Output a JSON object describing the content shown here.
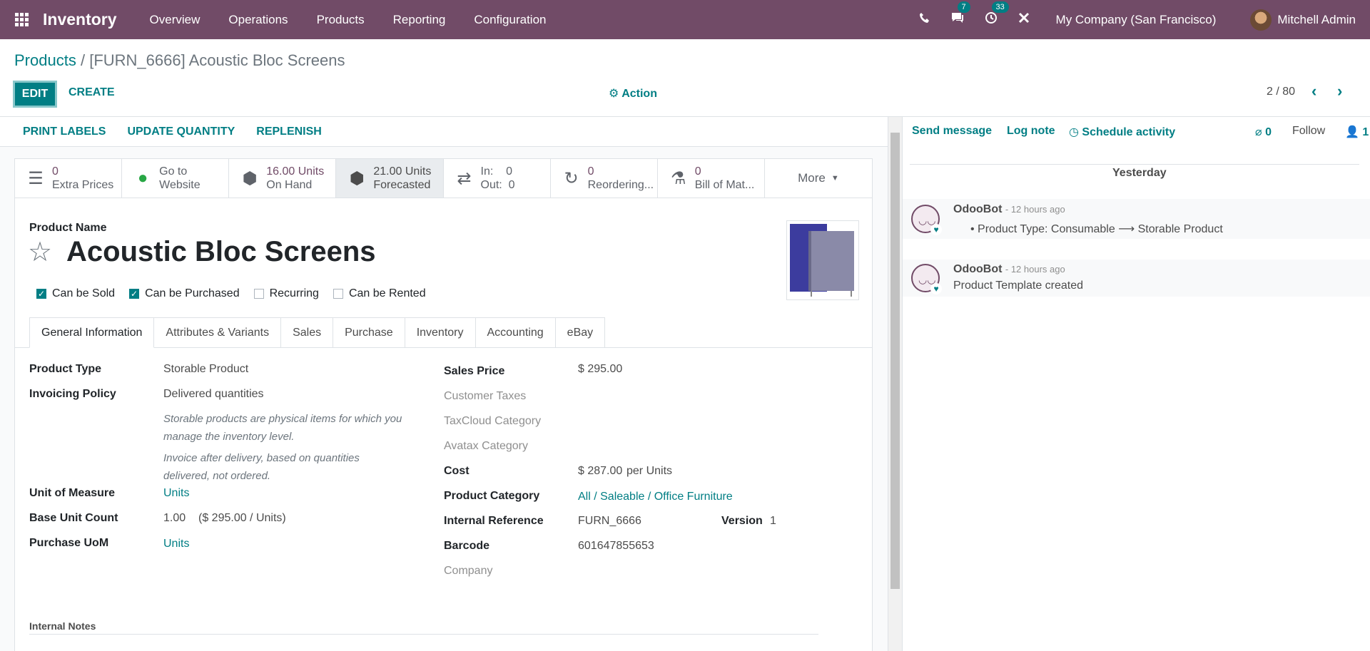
{
  "navbar": {
    "app_name": "Inventory",
    "menus": [
      "Overview",
      "Operations",
      "Products",
      "Reporting",
      "Configuration"
    ],
    "messages_count": "7",
    "activities_count": "33",
    "company": "My Company (San Francisco)",
    "user": "Mitchell Admin",
    "brand_color": "#714b67"
  },
  "control": {
    "breadcrumb_root": "Products",
    "breadcrumb_sep": "/",
    "breadcrumb_current": "[FURN_6666] Acoustic Bloc Screens",
    "edit_label": "EDIT",
    "create_label": "CREATE",
    "action_label": "Action",
    "pager": "2 / 80",
    "accent_color": "#017e84"
  },
  "statusbar": [
    "PRINT LABELS",
    "UPDATE QUANTITY",
    "REPLENISH"
  ],
  "smart_buttons": [
    {
      "icon": "list-icon",
      "value": "0",
      "label": "Extra Prices"
    },
    {
      "icon": "globe-icon",
      "value": "Go to",
      "label": "Website"
    },
    {
      "icon": "cubes-icon",
      "value": "16.00 Units",
      "label": "On Hand"
    },
    {
      "icon": "cubes-icon",
      "value": "21.00 Units",
      "label": "Forecasted"
    },
    {
      "icon": "exchange-icon",
      "value": "In:    0",
      "label": "Out:  0"
    },
    {
      "icon": "refresh-icon",
      "value": "0",
      "label": "Reordering..."
    },
    {
      "icon": "flask-icon",
      "value": "0",
      "label": "Bill of Mat..."
    }
  ],
  "smart_more": "More",
  "product": {
    "name_label": "Product Name",
    "name": "Acoustic Bloc Screens",
    "checkboxes": [
      {
        "label": "Can be Sold",
        "checked": true
      },
      {
        "label": "Can be Purchased",
        "checked": true
      },
      {
        "label": "Recurring",
        "checked": false
      },
      {
        "label": "Can be Rented",
        "checked": false
      }
    ]
  },
  "tabs": [
    "General Information",
    "Attributes & Variants",
    "Sales",
    "Purchase",
    "Inventory",
    "Accounting",
    "eBay"
  ],
  "left_fields": {
    "product_type_label": "Product Type",
    "product_type": "Storable Product",
    "invoicing_policy_label": "Invoicing Policy",
    "invoicing_policy": "Delivered quantities",
    "help_1": "Storable products are physical items for which you manage the inventory level.",
    "help_2": "Invoice after delivery, based on quantities delivered, not ordered.",
    "uom_label": "Unit of Measure",
    "uom": "Units",
    "base_unit_count_label": "Base Unit Count",
    "base_unit_count": "1.00",
    "base_unit_price": "($ 295.00 / Units)",
    "purchase_uom_label": "Purchase UoM",
    "purchase_uom": "Units"
  },
  "right_fields": {
    "sales_price_label": "Sales Price",
    "sales_price": "$ 295.00",
    "customer_taxes_label": "Customer Taxes",
    "taxcloud_label": "TaxCloud Category",
    "avatax_label": "Avatax Category",
    "cost_label": "Cost",
    "cost": "$ 287.00",
    "cost_unit": "per Units",
    "category_label": "Product Category",
    "category": "All / Saleable / Office Furniture",
    "internal_ref_label": "Internal Reference",
    "internal_ref": "FURN_6666",
    "version_label": "Version",
    "version": "1",
    "barcode_label": "Barcode",
    "barcode": "601647855653",
    "company_label": "Company"
  },
  "notes_label": "Internal Notes",
  "chatter": {
    "send_message": "Send message",
    "log_note": "Log note",
    "schedule_activity": "Schedule activity",
    "attachments": "0",
    "follow": "Follow",
    "followers": "1",
    "date_separator": "Yesterday",
    "messages": [
      {
        "author": "OdooBot",
        "date": "- 12 hours ago",
        "body": "Product Type: Consumable ⟶ Storable Product"
      },
      {
        "author": "OdooBot",
        "date": "- 12 hours ago",
        "body": "Product Template created"
      }
    ]
  }
}
